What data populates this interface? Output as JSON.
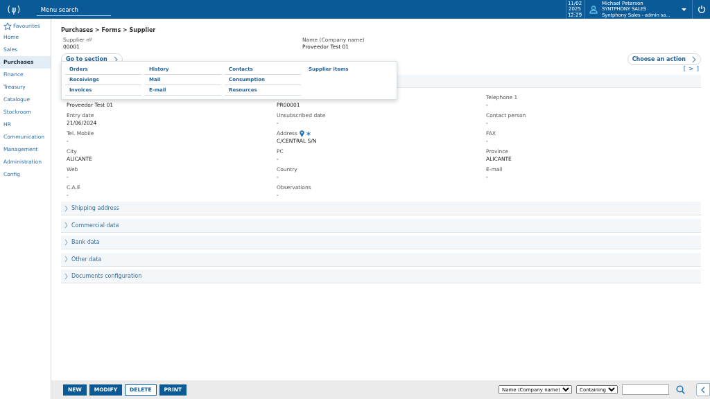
{
  "header": {
    "logo": "(ψ)",
    "menu_search": {
      "placeholder": "Menu search"
    },
    "date": "11/02 2025",
    "time": "12:29",
    "user": {
      "name": "Michael Peterson",
      "company": "SYNTPHONY SALES",
      "role": "Syntphony Sales - admin sa..."
    }
  },
  "sidebar": {
    "favourites": "Favourites",
    "items": [
      {
        "label": "Home",
        "selected": false
      },
      {
        "label": "Sales",
        "selected": false
      },
      {
        "label": "Purchases",
        "selected": true
      },
      {
        "label": "Finance",
        "selected": false
      },
      {
        "label": "Treasury",
        "selected": false
      },
      {
        "label": "Catalogue",
        "selected": false
      },
      {
        "label": "Stockroom",
        "selected": false
      },
      {
        "label": "HR",
        "selected": false
      },
      {
        "label": "Communication",
        "selected": false
      },
      {
        "label": "Management",
        "selected": false
      },
      {
        "label": "Administration",
        "selected": false
      },
      {
        "label": "Config",
        "selected": false
      }
    ]
  },
  "breadcrumb": "Purchases > Forms > Supplier",
  "summary": [
    {
      "label": "Supplier nº",
      "value": "00001"
    },
    {
      "label": "Name (Company name)",
      "value": "Proveedor Test 01"
    }
  ],
  "go_to_section": {
    "label": "Go to section",
    "columns": [
      [
        "Orders",
        "Receivings",
        "Invoices"
      ],
      [
        "History",
        "Mail",
        "E-mail"
      ],
      [
        "Contacts",
        "Consumption",
        "Resources"
      ],
      [
        "Supplier items"
      ]
    ]
  },
  "choose_action": "Choose an action",
  "expand_toggle": "[ > ]",
  "fields": [
    [
      {
        "value": "Proveedor Test 01"
      },
      {
        "value": "PR00001"
      },
      {
        "label": "Telephone 1",
        "value": "-"
      }
    ],
    [
      {
        "label": "Entry date",
        "value": "21/06/2024"
      },
      {
        "label": "Unsubscribed date",
        "value": "-"
      },
      {
        "label": "Contact person",
        "value": "-"
      }
    ],
    [
      {
        "label": "Tel. Mobile",
        "value": "-"
      },
      {
        "label": "Address",
        "value": "C/CENTRAL S/N",
        "map_pin": true,
        "required": true
      },
      {
        "label": "FAX",
        "value": "-"
      }
    ],
    [
      {
        "label": "City",
        "value": "ALICANTE"
      },
      {
        "label": "PC",
        "value": "-"
      },
      {
        "label": "Province",
        "value": "ALICANTE"
      }
    ],
    [
      {
        "label": "Web",
        "value": "-"
      },
      {
        "label": "Country",
        "value": "-"
      },
      {
        "label": "E-mail",
        "value": "-"
      }
    ],
    [
      {
        "label": "C.A.E",
        "value": "-"
      },
      {
        "label": "Observations",
        "value": "-"
      }
    ]
  ],
  "sections": [
    {
      "label": "Shipping address",
      "expanded": false
    },
    {
      "label": "Commercial data",
      "expanded": false
    },
    {
      "label": "Bank data",
      "expanded": false
    },
    {
      "label": "Other data",
      "expanded": false
    },
    {
      "label": "Documents configuration",
      "expanded": false
    }
  ],
  "footer": {
    "buttons": [
      {
        "label": "NEW",
        "kind": "filled"
      },
      {
        "label": "MODIFY",
        "kind": "filled"
      },
      {
        "label": "DELETE",
        "kind": "outline"
      },
      {
        "label": "PRINT",
        "kind": "filled"
      }
    ],
    "search_field": "Name (Company name)",
    "search_mode": "Containing"
  }
}
